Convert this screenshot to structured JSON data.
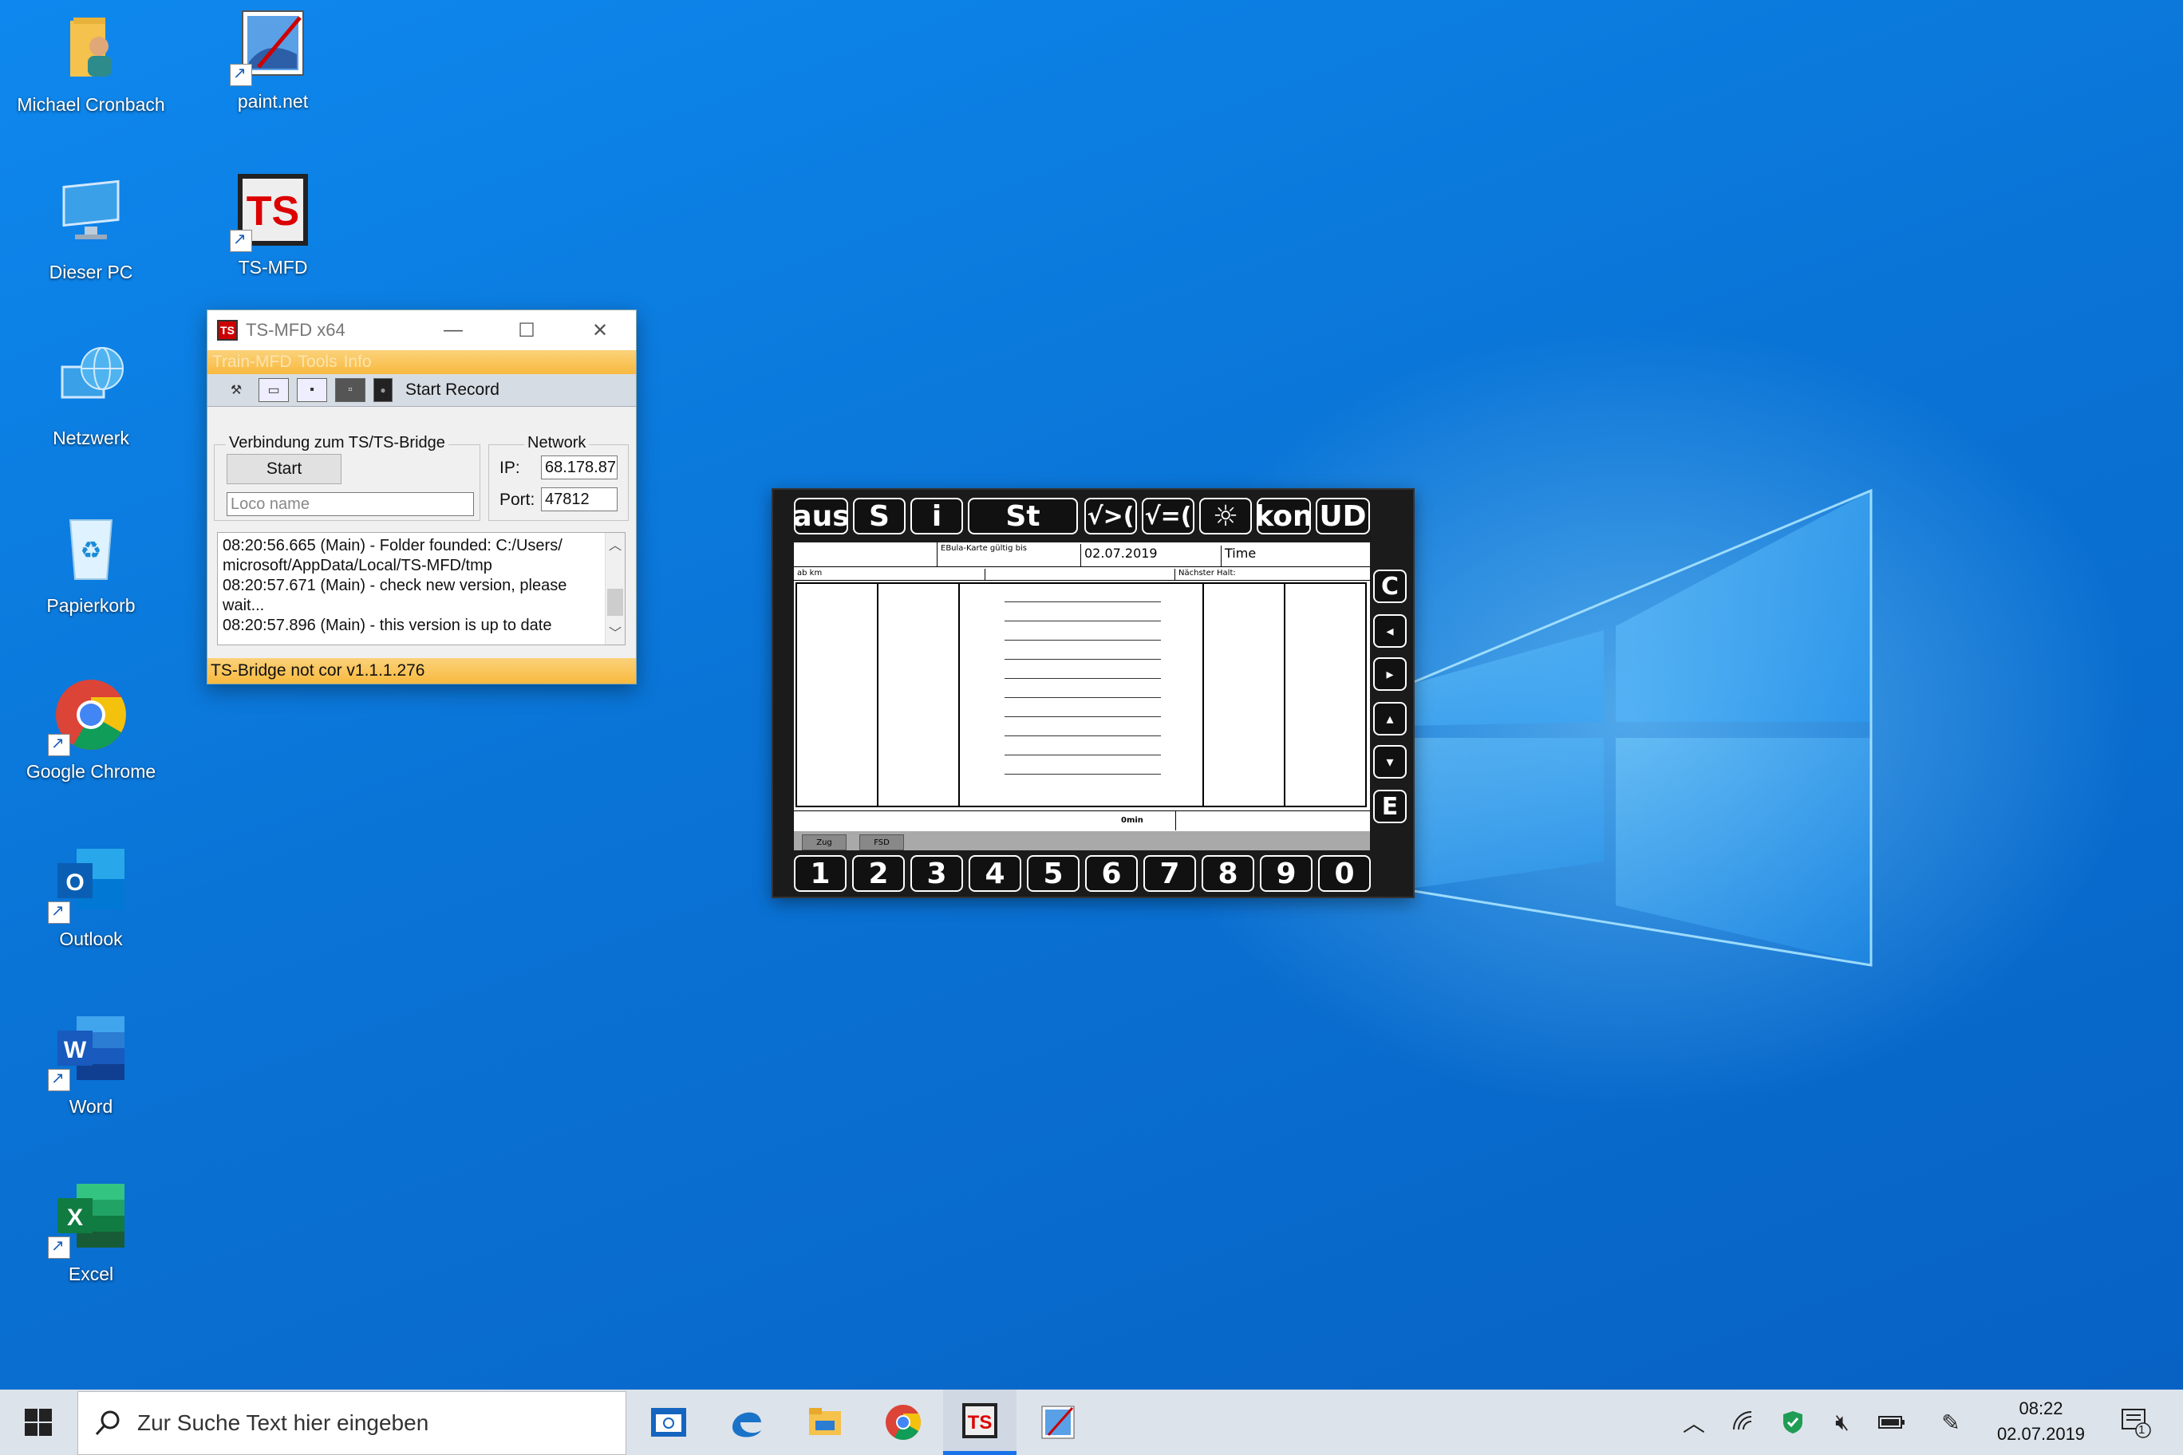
{
  "desktop": {
    "icons": [
      {
        "label": "Michael Cronbach"
      },
      {
        "label": "paint.net"
      },
      {
        "label": "Dieser PC"
      },
      {
        "label": "TS-MFD"
      },
      {
        "label": "Netzwerk"
      },
      {
        "label": "Papierkorb"
      },
      {
        "label": "Google Chrome"
      },
      {
        "label": "Outlook"
      },
      {
        "label": "Word"
      },
      {
        "label": "Excel"
      }
    ]
  },
  "app": {
    "title": "TS-MFD x64",
    "menu": [
      "Train-MFD",
      "Tools",
      "Info"
    ],
    "toolbar": {
      "record_label": "Start Record"
    },
    "connection": {
      "group_label": "Verbindung zum TS/TS-Bridge",
      "start_label": "Start",
      "loco_placeholder": "Loco name"
    },
    "network": {
      "group_label": "Network",
      "ip_label": "IP:",
      "ip_value": "68.178.87",
      "port_label": "Port:",
      "port_value": "47812"
    },
    "log": [
      "08:20:56.665 (Main) - Folder founded: C:/Users/",
      "microsoft/AppData/Local/TS-MFD/tmp",
      "08:20:57.671 (Main) - check new version, please",
      "wait...",
      "08:20:57.896 (Main) - this version is up to date"
    ],
    "status": "TS-Bridge not cor v1.1.1.276"
  },
  "mfd": {
    "top_keys": [
      "aus",
      "S",
      "i",
      "St",
      "√>(",
      "√=(",
      "☼",
      "kon",
      "UD"
    ],
    "side_keys": [
      "C",
      "◂",
      "▸",
      "▴",
      "▾",
      "E"
    ],
    "num_keys": [
      "1",
      "2",
      "3",
      "4",
      "5",
      "6",
      "7",
      "8",
      "9",
      "0"
    ],
    "screen": {
      "ebula_label": "EBula-Karte gültig bis",
      "date": "02.07.2019",
      "time_label": "Time",
      "abkm_label": "ab km",
      "next_stop_label": "Nächster Halt:",
      "delay": "0min",
      "btn_zug": "Zug",
      "btn_fsd": "FSD"
    }
  },
  "taskbar": {
    "search_placeholder": "Zur Suche Text hier eingeben",
    "time": "08:22",
    "date": "02.07.2019",
    "notification_count": "1"
  }
}
